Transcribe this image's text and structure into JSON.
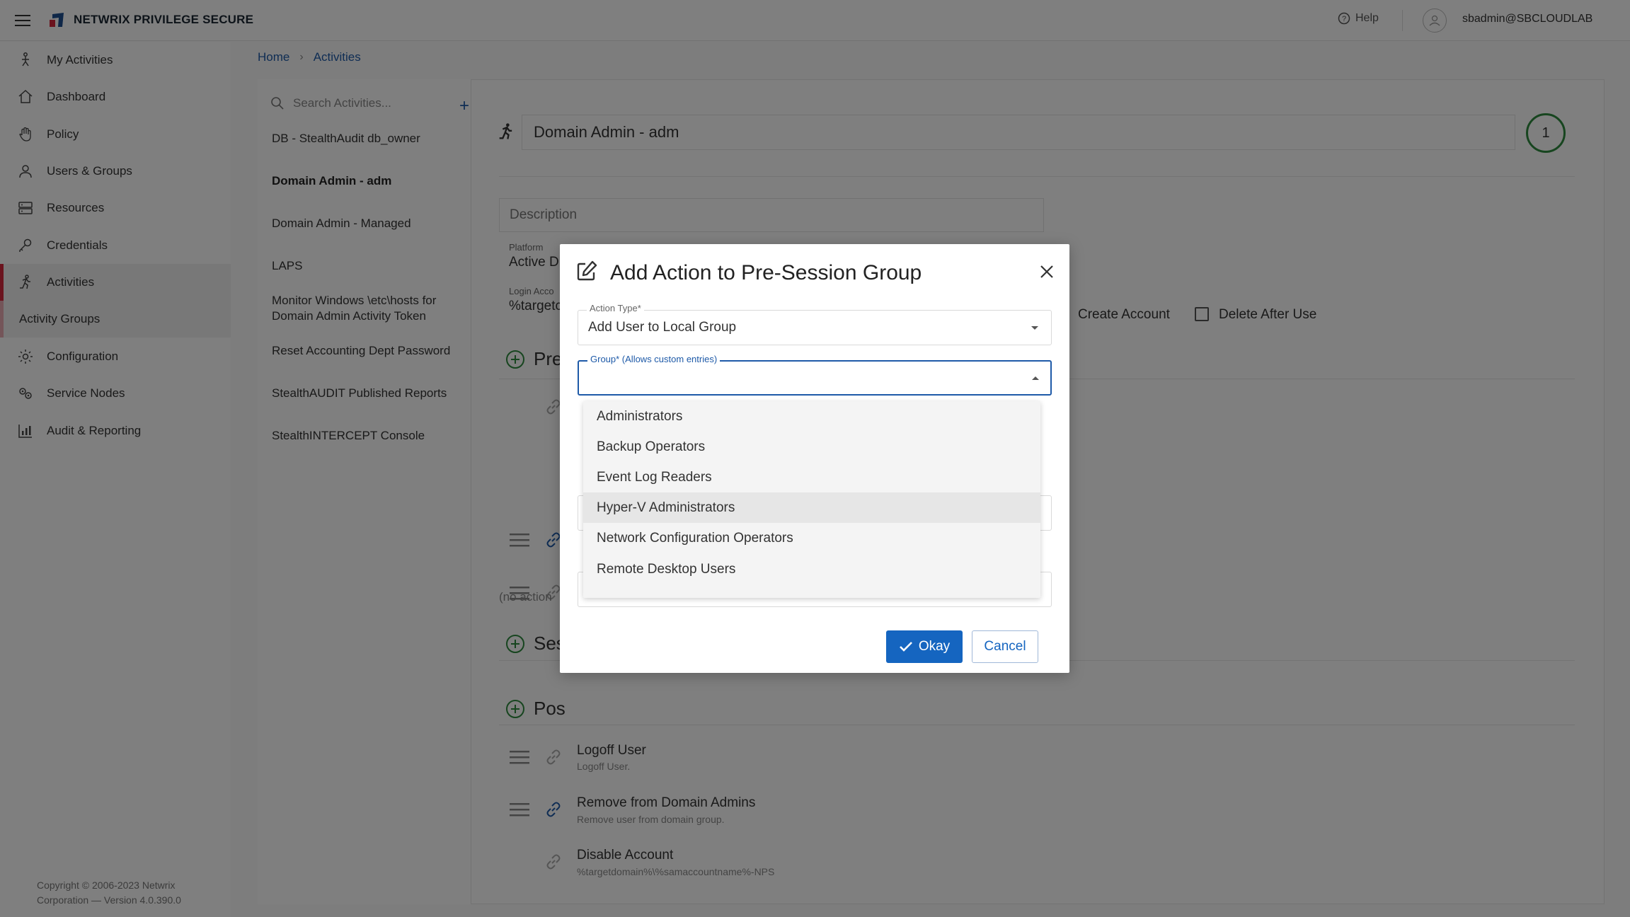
{
  "app": {
    "brand": "NETWRIX PRIVILEGE SECURE",
    "help_label": "Help",
    "username": "sbadmin@SBCLOUDLAB",
    "accent_color": "#d6273c",
    "primary_color": "#1565c0"
  },
  "sidebar": {
    "items": [
      {
        "label": "My Activities",
        "icon": "person-walking-icon"
      },
      {
        "label": "Dashboard",
        "icon": "home-icon"
      },
      {
        "label": "Policy",
        "icon": "hand-icon"
      },
      {
        "label": "Users & Groups",
        "icon": "user-icon"
      },
      {
        "label": "Resources",
        "icon": "server-icon"
      },
      {
        "label": "Credentials",
        "icon": "key-icon"
      },
      {
        "label": "Activities",
        "icon": "running-icon"
      },
      {
        "label": "Activity Groups"
      },
      {
        "label": "Configuration",
        "icon": "gear-icon"
      },
      {
        "label": "Service Nodes",
        "icon": "service-nodes-icon"
      },
      {
        "label": "Audit & Reporting",
        "icon": "chart-icon"
      }
    ],
    "copyright": "Copyright © 2006-2023 Netwrix Corporation — Version 4.0.390.0"
  },
  "breadcrumb": {
    "home": "Home",
    "current": "Activities"
  },
  "activity_list": {
    "search_placeholder": "Search Activities...",
    "items": [
      "DB - StealthAudit db_owner",
      "Domain Admin - adm",
      "Domain Admin - Managed",
      "LAPS",
      "Monitor Windows \\etc\\hosts for Domain Admin Activity Token",
      "Reset Accounting Dept Password",
      "StealthAUDIT Published Reports",
      "StealthINTERCEPT Console"
    ],
    "selected_index": 1
  },
  "detail": {
    "title": "Domain Admin - adm",
    "step": "1",
    "description_placeholder": "Description",
    "platform_label": "Platform",
    "platform_value": "Active D",
    "login_label": "Login Acco",
    "login_value": "%targetc",
    "create_account": "Create Account",
    "delete_after_use": "Delete After Use",
    "sections": {
      "pre": "Pre",
      "session": "Ses",
      "post": "Pos"
    },
    "no_actions": "(no action",
    "post_actions": [
      {
        "title": "Logoff User",
        "sub": "Logoff User."
      },
      {
        "title": "Remove from Domain Admins",
        "sub": "Remove user from domain group."
      },
      {
        "title": "Disable Account",
        "sub": "%targetdomain%\\%samaccountname%-NPS"
      }
    ]
  },
  "modal": {
    "title": "Add Action to Pre-Session Group",
    "action_type_label": "Action Type*",
    "action_type_value": "Add User to Local Group",
    "group_label": "Group* (Allows custom entries)",
    "group_value": "",
    "options": [
      "Administrators",
      "Backup Operators",
      "Event Log Readers",
      "Hyper-V Administrators",
      "Network Configuration Operators",
      "Remote Desktop Users"
    ],
    "hovered_option_index": 3,
    "okay_label": "Okay",
    "cancel_label": "Cancel"
  }
}
